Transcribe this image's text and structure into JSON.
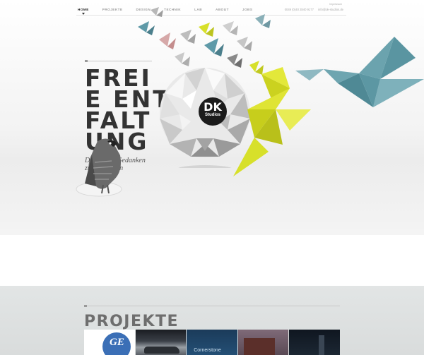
{
  "nav": {
    "items": [
      {
        "label": "HOME",
        "active": true
      },
      {
        "label": "PROJEKTE",
        "active": false
      },
      {
        "label": "DESIGN",
        "active": false
      },
      {
        "label": "TECHNIK",
        "active": false
      },
      {
        "label": "LAB",
        "active": false
      },
      {
        "label": "ABOUT",
        "active": false
      },
      {
        "label": "JOBS",
        "active": false
      }
    ],
    "impressum": "Impressum",
    "phone": "0049 (0)40 2840 9177",
    "email": "info@ok-studios.de"
  },
  "hero": {
    "headline_lines": [
      "FREI",
      "E ENT",
      "FALT",
      "UNG"
    ],
    "tagline": "Die Kunst, Gedanken zu entwickeln",
    "logo_main": "DK",
    "logo_sub": "Studios"
  },
  "projects": {
    "title": "PROJEKTE",
    "thumb_labels": [
      "GE",
      "",
      "Cornerstone",
      "",
      ""
    ]
  },
  "colors": {
    "accent_yellow": "#d7e02a",
    "accent_teal": "#5f9aa8",
    "headline": "#333333"
  }
}
